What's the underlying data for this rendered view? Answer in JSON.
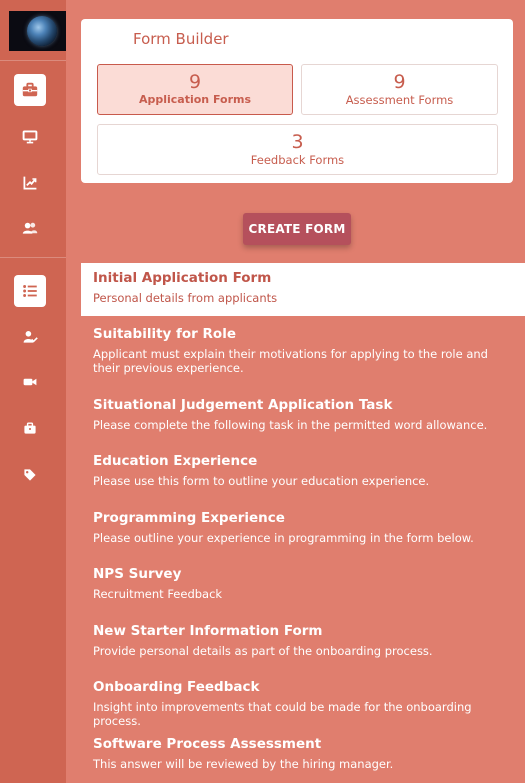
{
  "colors": {
    "background": "#e07e6e",
    "sidebar": "#cf6552",
    "accent": "#c75d4e",
    "create_button": "#b5505c",
    "active_stat_bg": "#fbdcd6"
  },
  "sidebar": {
    "logo": "earth-logo",
    "items": [
      {
        "icon": "briefcase-icon",
        "active": true
      },
      {
        "icon": "presentation-icon",
        "active": false
      },
      {
        "icon": "chart-line-icon",
        "active": false
      },
      {
        "icon": "users-icon",
        "active": false
      },
      {
        "icon": "list-icon",
        "active": true
      },
      {
        "icon": "user-check-icon",
        "active": false
      },
      {
        "icon": "video-camera-icon",
        "active": false
      },
      {
        "icon": "suitcase-icon",
        "active": false
      },
      {
        "icon": "tag-icon",
        "active": false
      }
    ]
  },
  "form_builder": {
    "title": "Form Builder",
    "stats": [
      {
        "count": "9",
        "label": "Application Forms",
        "active": true
      },
      {
        "count": "9",
        "label": "Assessment Forms",
        "active": false
      },
      {
        "count": "3",
        "label": "Feedback Forms",
        "active": false
      }
    ]
  },
  "create_button_label": "CREATE FORM",
  "forms": [
    {
      "title": "Initial Application Form",
      "description": "Personal details from applicants",
      "selected": true
    },
    {
      "title": "Suitability for Role",
      "description": "Applicant must explain their motivations for applying to the role and their previous experience.",
      "selected": false
    },
    {
      "title": "Situational Judgement Application Task",
      "description": "Please complete the following task in the permitted word allowance.",
      "selected": false
    },
    {
      "title": "Education Experience",
      "description": "Please use this form to outline your education experience.",
      "selected": false
    },
    {
      "title": "Programming Experience",
      "description": "Please outline your experience in programming in the form below.",
      "selected": false
    },
    {
      "title": "NPS Survey",
      "description": "Recruitment Feedback",
      "selected": false
    },
    {
      "title": "New Starter Information Form",
      "description": "Provide personal details as part of the onboarding process.",
      "selected": false
    },
    {
      "title": "Onboarding Feedback",
      "description": "Insight into improvements that could be made for the onboarding process.",
      "selected": false
    },
    {
      "title": "Software Process Assessment",
      "description": "This answer will be reviewed by the hiring manager.",
      "selected": false
    }
  ]
}
